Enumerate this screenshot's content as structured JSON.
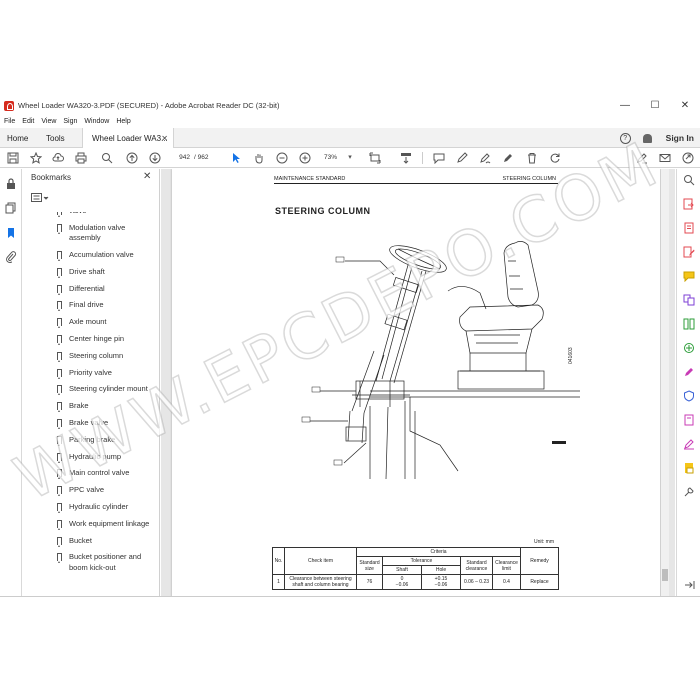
{
  "window": {
    "title": "Wheel Loader WA320-3.PDF (SECURED) - Adobe Acrobat Reader DC (32-bit)",
    "controls": [
      "—",
      "☐",
      "✕"
    ]
  },
  "menu": [
    "File",
    "Edit",
    "View",
    "Sign",
    "Window",
    "Help"
  ],
  "tabs": {
    "home": "Home",
    "tools": "Tools",
    "document": "Wheel Loader WA3...",
    "close": "✕",
    "sign_in": "Sign In",
    "help": "?"
  },
  "toolbar": {
    "current_page": "942",
    "total_pages": "/ 962",
    "zoom": "73%"
  },
  "bookmarks": {
    "title": "Bookmarks",
    "close": "✕",
    "items": [
      "valve",
      "Modulation valve assembly",
      "Accumulation valve",
      "Drive shaft",
      "Differential",
      "Final drive",
      "Axle mount",
      "Center hinge pin",
      "Steering column",
      "Priority valve",
      "Steering cylinder mount",
      "Brake",
      "Brake valve",
      "Parking brake",
      "Hydraulic pump",
      "Main control valve",
      "PPC valve",
      " Hydraulic cylinder",
      "Work equipment linkage",
      "Bucket",
      "Bucket positioner and boom kick-out"
    ]
  },
  "document": {
    "header_left": "MAINTENANCE STANDARD",
    "header_right": "STEERING COLUMN",
    "title": "STEERING  COLUMN",
    "side_code": "041603",
    "unit": "Unit: mm",
    "table": {
      "headers": {
        "no": "No.",
        "check_item": "Check item",
        "criteria": "Criteria",
        "remedy": "Remedy"
      },
      "sub_headers": {
        "standard_size": "Standard size",
        "tolerance": "Tolerance",
        "shaft": "Shaft",
        "hole": "Hole",
        "standard_clearance": "Standard clearance",
        "clearance_limit": "Clearance limit"
      },
      "row": {
        "no": "1",
        "check_item": "Clearance between steering shaft and column bearing",
        "standard_size": "76",
        "shaft": "0\n−0.06",
        "hole": "+0.15\n−0.06",
        "standard_clearance": "0.06 – 0.23",
        "clearance_limit": "0.4",
        "remedy": "Replace"
      }
    }
  },
  "watermark": "WWW.EPCDEPO.COM"
}
